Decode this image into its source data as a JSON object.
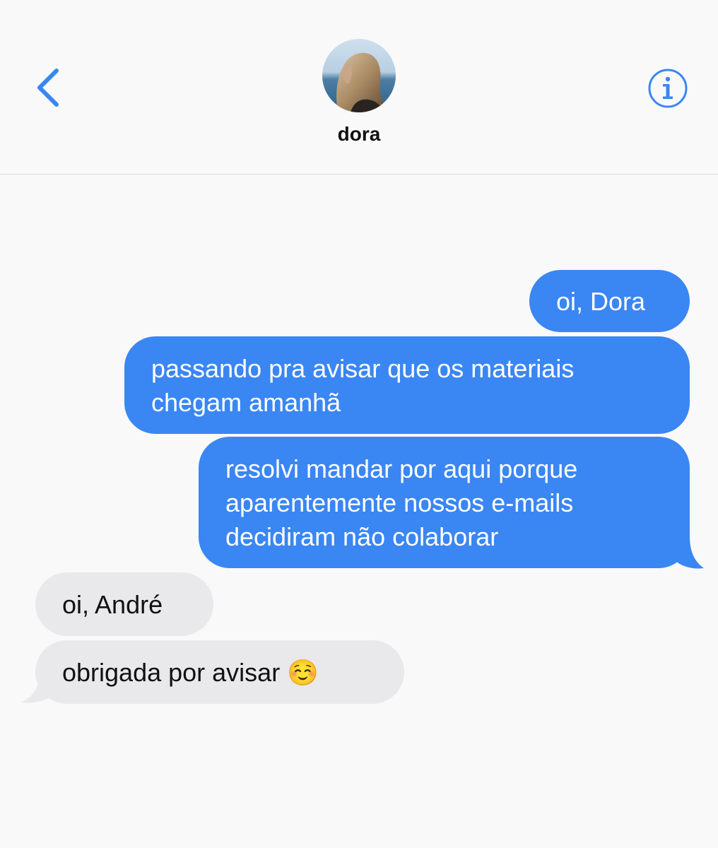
{
  "header": {
    "contact_name": "dora",
    "back_icon": "chevron-left-icon",
    "info_icon": "info-circle-icon"
  },
  "colors": {
    "accent": "#3a86f3",
    "outgoing_bubble": "#3a86f3",
    "incoming_bubble": "#e9e9eb",
    "background": "#f9f9f9"
  },
  "messages": [
    {
      "direction": "outgoing",
      "text": "oi, Dora"
    },
    {
      "direction": "outgoing",
      "text": "passando pra avisar que os materiais\nchegam amanhã"
    },
    {
      "direction": "outgoing",
      "text": "resolvi mandar por aqui porque\naparentemente nossos e-mails\ndecidiram não colaborar"
    },
    {
      "direction": "incoming",
      "text": "oi, André"
    },
    {
      "direction": "incoming",
      "text": "obrigada por avisar ☺️"
    }
  ]
}
